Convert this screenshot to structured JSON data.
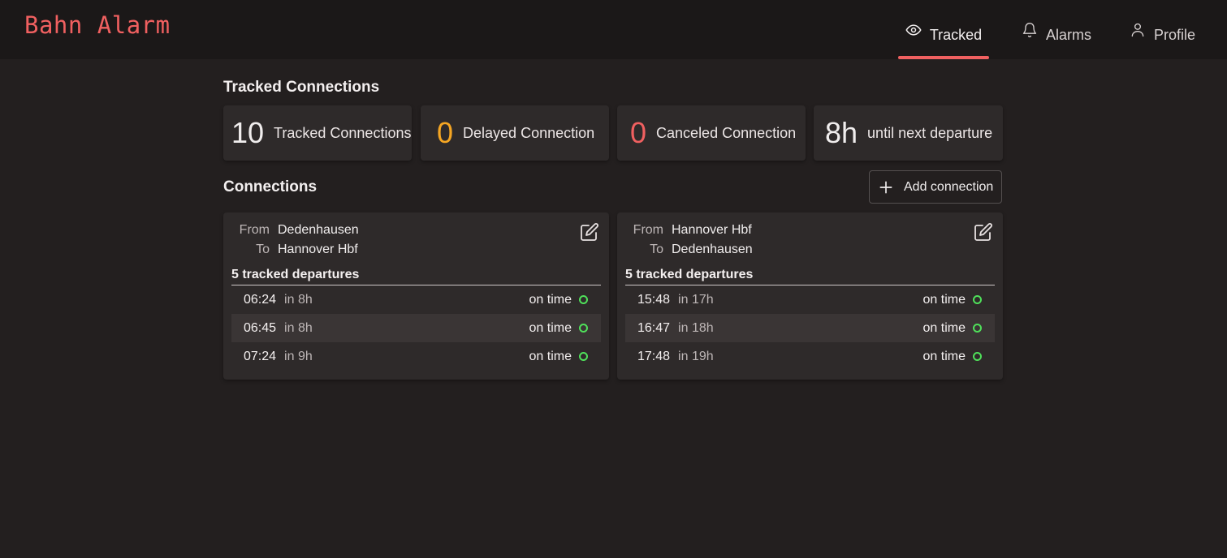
{
  "app": {
    "title": "Bahn Alarm",
    "brand_color": "#f06060"
  },
  "nav": {
    "items": [
      {
        "label": "Tracked",
        "icon": "eye-icon",
        "active": true
      },
      {
        "label": "Alarms",
        "icon": "bell-icon",
        "active": false
      },
      {
        "label": "Profile",
        "icon": "user-icon",
        "active": false
      }
    ]
  },
  "summary": {
    "title": "Tracked Connections",
    "stats": [
      {
        "value": "10",
        "label": "Tracked Connections",
        "color": "#f0eded"
      },
      {
        "value": "0",
        "label": "Delayed Connection",
        "color": "#f5a623"
      },
      {
        "value": "0",
        "label": "Canceled Connection",
        "color": "#f06060"
      },
      {
        "value": "8h",
        "label": "until next departure",
        "color": "#f0eded"
      }
    ]
  },
  "connections": {
    "title": "Connections",
    "add_label": "Add connection",
    "from_label": "From",
    "to_label": "To",
    "cards": [
      {
        "from": "Dedenhausen",
        "to": "Hannover Hbf",
        "departures_heading": "5 tracked departures",
        "departures": [
          {
            "time": "06:24",
            "relative": "in 8h",
            "status": "on time"
          },
          {
            "time": "06:45",
            "relative": "in 8h",
            "status": "on time"
          },
          {
            "time": "07:24",
            "relative": "in 9h",
            "status": "on time"
          }
        ]
      },
      {
        "from": "Hannover Hbf",
        "to": "Dedenhausen",
        "departures_heading": "5 tracked departures",
        "departures": [
          {
            "time": "15:48",
            "relative": "in 17h",
            "status": "on time"
          },
          {
            "time": "16:47",
            "relative": "in 18h",
            "status": "on time"
          },
          {
            "time": "17:48",
            "relative": "in 19h",
            "status": "on time"
          }
        ]
      }
    ]
  },
  "status_color_on_time": "#4fe05a"
}
